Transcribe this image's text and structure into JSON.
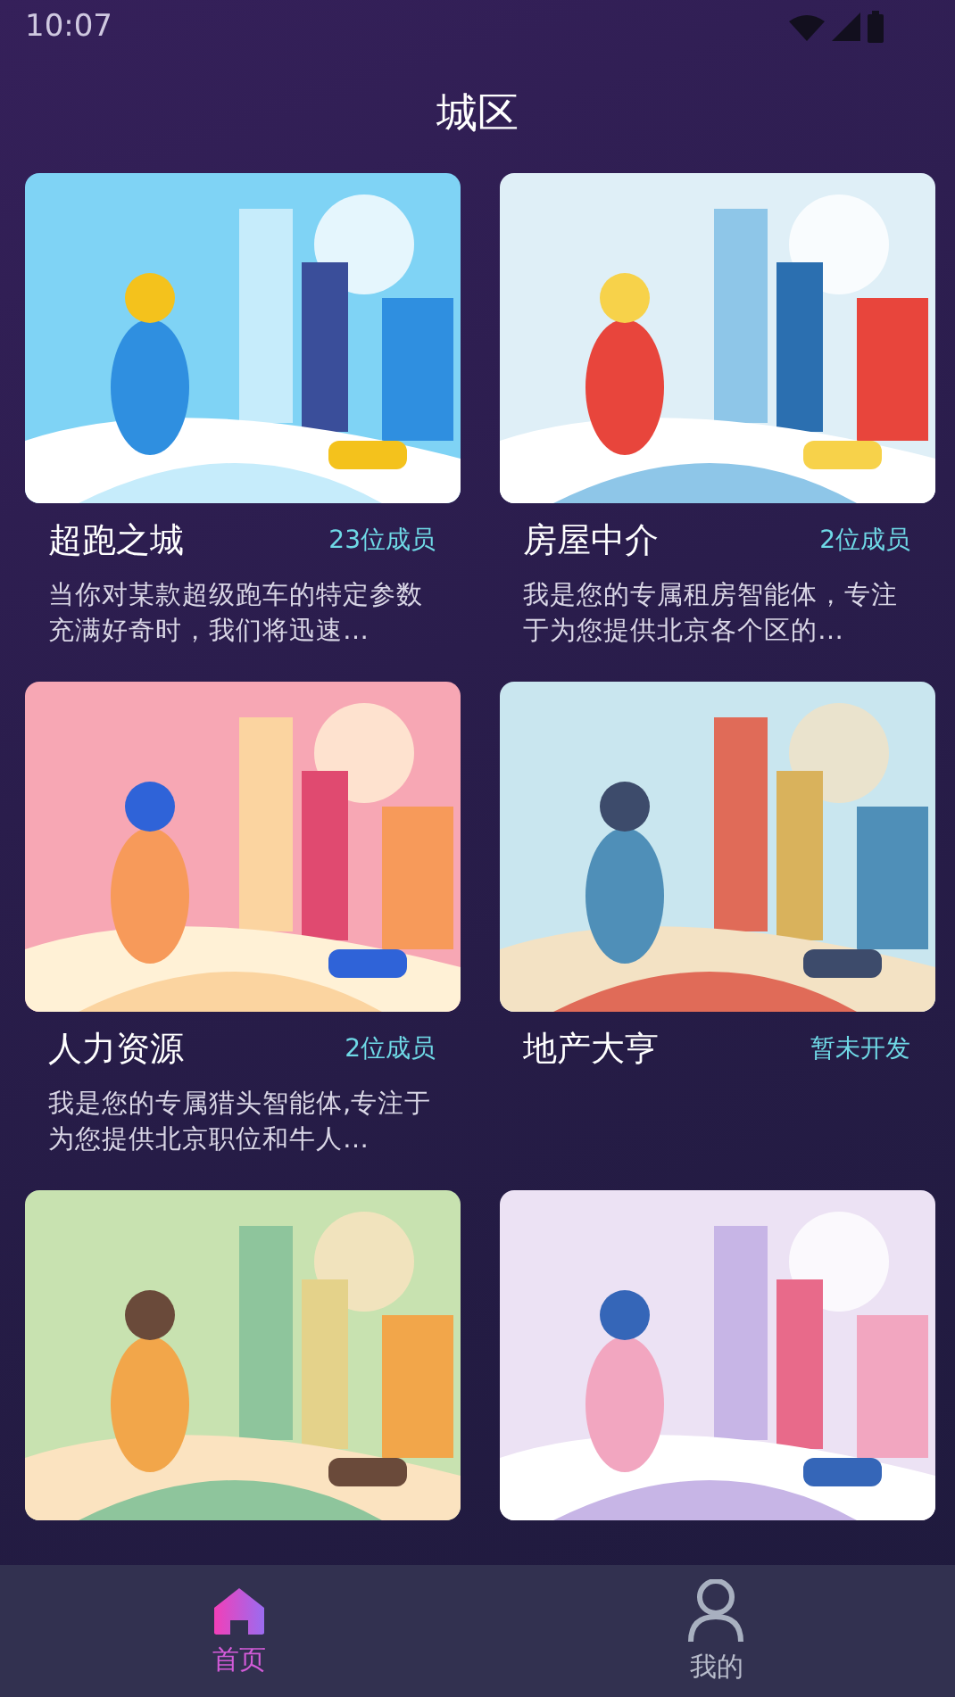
{
  "status_bar": {
    "time": "10:07"
  },
  "header": {
    "title": "城区"
  },
  "cards": [
    {
      "title": "超跑之城",
      "badge": "23位成员",
      "description": "当你对某款超级跑车的特定参数充满好奇时，我们将迅速…",
      "picture": {
        "kind": "picture"
      }
    },
    {
      "title": "房屋中介",
      "badge": "2位成员",
      "description": "我是您的专属租房智能体，专注于为您提供北京各个区的…",
      "picture": {
        "kind": "picture"
      }
    },
    {
      "title": "人力资源",
      "badge": "2位成员",
      "description": "我是您的专属猎头智能体,专注于为您提供北京职位和牛人…",
      "picture": {
        "kind": "picture"
      }
    },
    {
      "title": "地产大亨",
      "badge": "暂未开发",
      "picture": {
        "kind": "picture"
      }
    },
    {
      "picture": {
        "kind": "picture"
      }
    },
    {
      "picture": {
        "kind": "picture"
      }
    }
  ],
  "nav": [
    {
      "label": "首页",
      "kind": "home",
      "selected": true
    },
    {
      "label": "我的",
      "kind": "profile",
      "selected": false
    }
  ]
}
